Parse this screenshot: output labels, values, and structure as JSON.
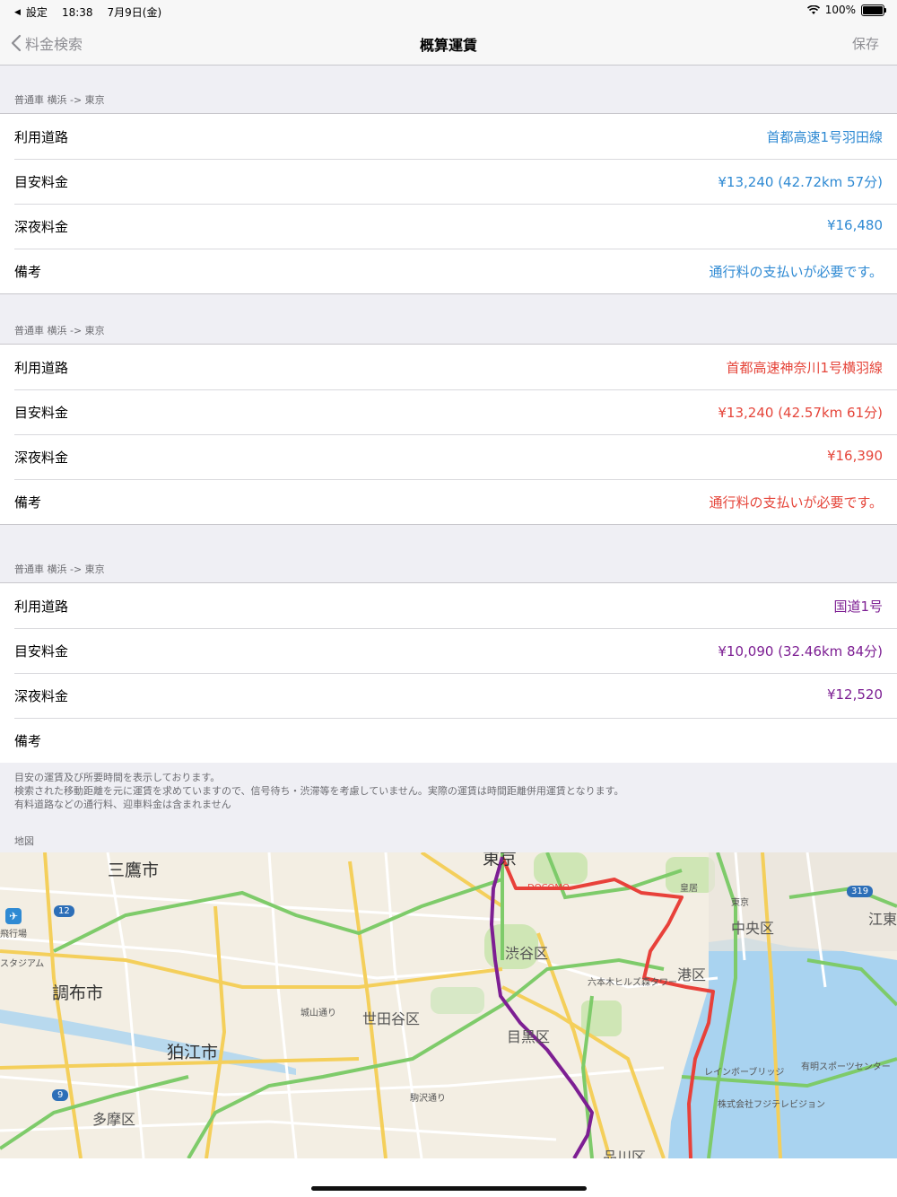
{
  "status_bar": {
    "back_app": "設定",
    "time": "18:38",
    "date": "7月9日(金)",
    "battery": "100%"
  },
  "nav": {
    "back_label": "料金検索",
    "title": "概算運賃",
    "save_label": "保存"
  },
  "routes": [
    {
      "header": "普通車 横浜 -> 東京",
      "color": "#2f8ad3",
      "rows": [
        {
          "label": "利用道路",
          "value": "首都高速1号羽田線"
        },
        {
          "label": "目安料金",
          "value": "¥13,240 (42.72km 57分)"
        },
        {
          "label": "深夜料金",
          "value": "¥16,480"
        },
        {
          "label": "備考",
          "value": "通行料の支払いが必要です。"
        }
      ]
    },
    {
      "header": "普通車 横浜 -> 東京",
      "color": "#e5453a",
      "rows": [
        {
          "label": "利用道路",
          "value": "首都高速神奈川1号横羽線"
        },
        {
          "label": "目安料金",
          "value": "¥13,240 (42.57km 61分)"
        },
        {
          "label": "深夜料金",
          "value": "¥16,390"
        },
        {
          "label": "備考",
          "value": "通行料の支払いが必要です。"
        }
      ]
    },
    {
      "header": "普通車 横浜 -> 東京",
      "color": "#7d1f93",
      "rows": [
        {
          "label": "利用道路",
          "value": "国道1号"
        },
        {
          "label": "目安料金",
          "value": "¥10,090 (32.46km 84分)"
        },
        {
          "label": "深夜料金",
          "value": "¥12,520"
        },
        {
          "label": "備考",
          "value": ""
        }
      ]
    }
  ],
  "footer_lines": [
    "目安の運賃及び所要時間を表示しております。",
    "検索された移動距離を元に運賃を求めていますので、信号待ち・渋滞等を考慮していません。実際の運賃は時間距離併用運賃となります。",
    "有料道路などの通行料、迎車料金は含まれません"
  ],
  "map_header": "地図",
  "map_labels": {
    "mitaka": "三鷹市",
    "chofu": "調布市",
    "komae": "狛江市",
    "tama": "多摩区",
    "setagaya": "世田谷区",
    "meguro": "目黒区",
    "shibuya": "渋谷区",
    "minato": "港区",
    "chuo": "中央区",
    "koto": "江東",
    "shinagawa": "品川区",
    "tokyo": "東京",
    "roppongi": "六本木ヒルズ森タワー",
    "rainbow": "レインボーブリッジ",
    "ariake": "有明スポーツセンター",
    "fuji": "株式会社フジテレビジョン",
    "docomo": "DOCOMO",
    "koukyo": "皇居",
    "tokyo_station": "東京",
    "hiko": "飛行場",
    "stadium": "スタジアム",
    "route_319": "319",
    "route_12": "12",
    "route_9": "9",
    "komazawa": "駒沢通り",
    "joyama": "城山通り"
  }
}
